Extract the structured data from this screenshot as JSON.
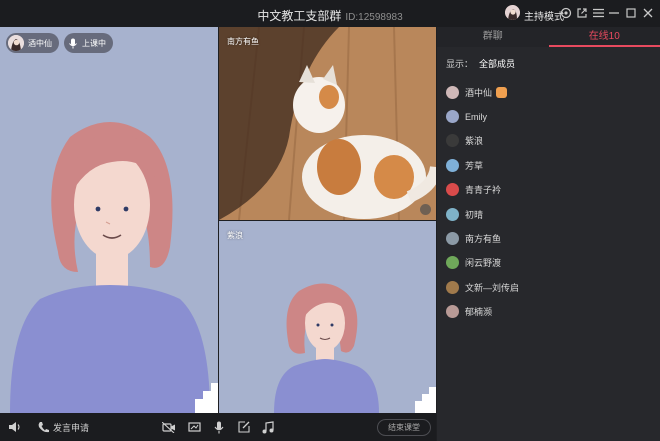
{
  "window": {
    "title": "中文教工支部群",
    "id_label": "ID:12598983",
    "host_mode_label": "主持模式"
  },
  "video": {
    "main": {
      "user_name": "酒中仙",
      "status_label": "上课中"
    },
    "top_right": {
      "user_name": "南方有鱼"
    },
    "bottom_right": {
      "user_name": "紫浪"
    }
  },
  "panel": {
    "tabs": [
      {
        "label": "群聊",
        "active": false
      },
      {
        "label": "在线10",
        "active": true
      }
    ],
    "filter_label": "显示：",
    "filter_value": "全部成员",
    "members": [
      {
        "name": "酒中仙",
        "avatar_color": "#cfb8b8",
        "host": true
      },
      {
        "name": "Emily",
        "avatar_color": "#9aa7c9"
      },
      {
        "name": "紫浪",
        "avatar_color": "#3a3a3a"
      },
      {
        "name": "芳草",
        "avatar_color": "#7fb0d8"
      },
      {
        "name": "青青子衿",
        "avatar_color": "#d94b4b"
      },
      {
        "name": "初晴",
        "avatar_color": "#7fb2c8"
      },
      {
        "name": "南方有鱼",
        "avatar_color": "#8c9aa6"
      },
      {
        "name": "闲云野渡",
        "avatar_color": "#6fa85a"
      },
      {
        "name": "文新—刘传启",
        "avatar_color": "#a07a4c"
      },
      {
        "name": "郁楠濒",
        "avatar_color": "#b89a96"
      }
    ]
  },
  "toolbar": {
    "apply_speak_label": "发言申请",
    "end_class_label": "结束课堂"
  },
  "colors": {
    "accent": "#e84a5f",
    "video_bg": "#a7b2ce",
    "panel_bg": "#27282c"
  }
}
